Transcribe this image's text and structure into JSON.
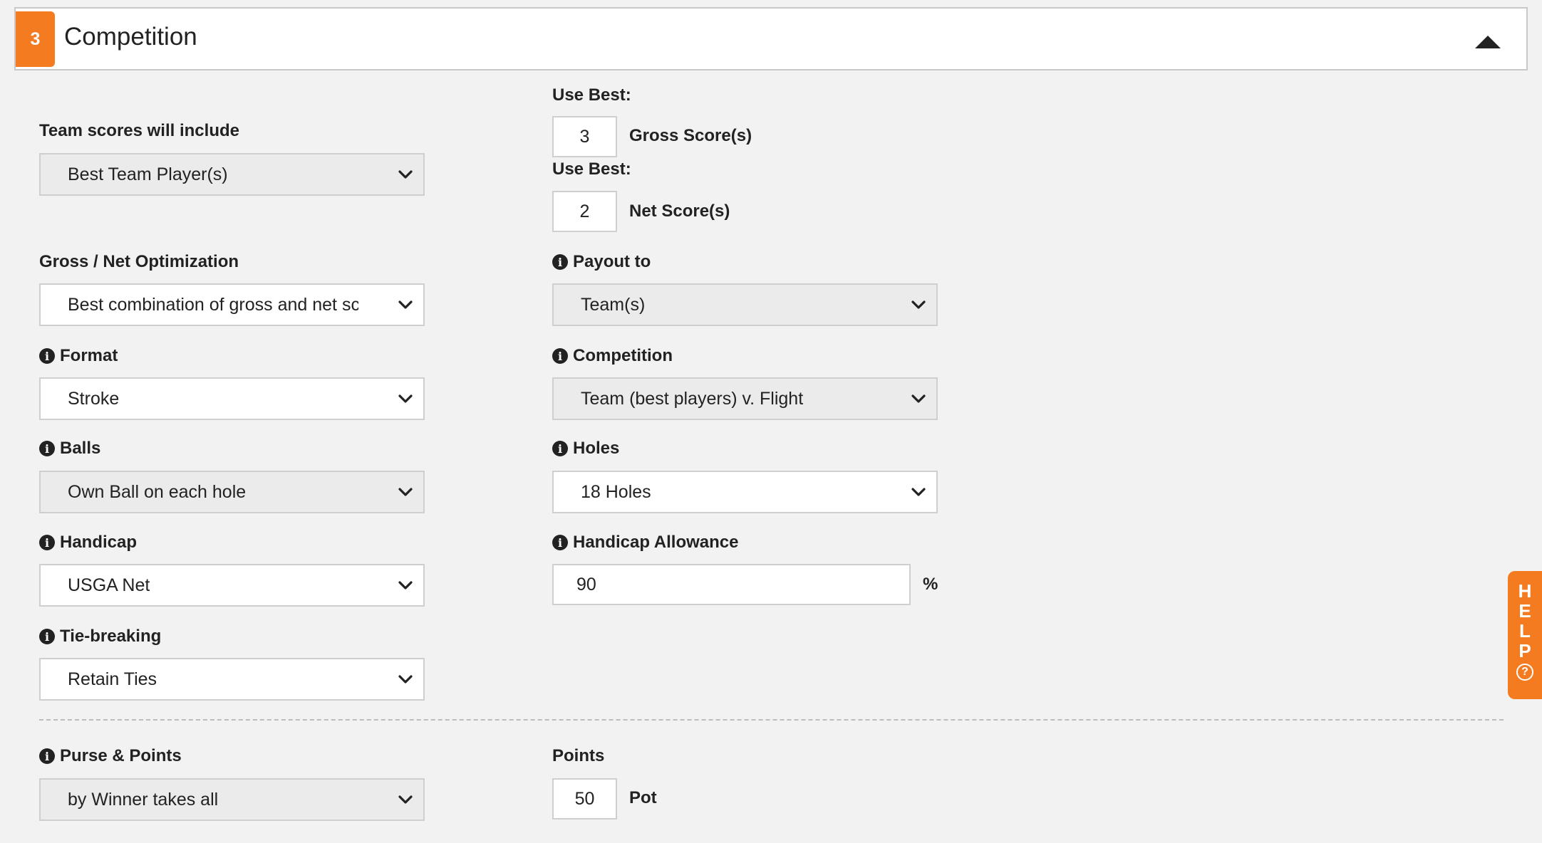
{
  "header": {
    "step_number": "3",
    "title": "Competition"
  },
  "left": {
    "team_scores": {
      "label": "Team scores will include",
      "value": "Best Team Player(s)"
    },
    "gross_net": {
      "label": "Gross / Net Optimization",
      "value": "Best combination of gross and net scores"
    },
    "format": {
      "label": "Format",
      "value": "Stroke"
    },
    "balls": {
      "label": "Balls",
      "value": "Own Ball on each hole"
    },
    "handicap": {
      "label": "Handicap",
      "value": "USGA Net"
    },
    "tie_breaking": {
      "label": "Tie-breaking",
      "value": "Retain Ties"
    },
    "purse_points": {
      "label": "Purse & Points",
      "value": "by Winner takes all"
    }
  },
  "right": {
    "use_best_gross": {
      "label": "Use Best:",
      "value": "3",
      "suffix": "Gross Score(s)"
    },
    "use_best_net": {
      "label": "Use Best:",
      "value": "2",
      "suffix": "Net Score(s)"
    },
    "payout_to": {
      "label": "Payout to",
      "value": "Team(s)"
    },
    "competition": {
      "label": "Competition",
      "value": "Team (best players) v. Flight"
    },
    "holes": {
      "label": "Holes",
      "value": "18 Holes"
    },
    "handicap_allowance": {
      "label": "Handicap Allowance",
      "value": "90",
      "suffix": "%"
    },
    "points": {
      "label": "Points",
      "value": "50",
      "suffix": "Pot"
    }
  },
  "help_tab": {
    "letters": [
      "H",
      "E",
      "L",
      "P"
    ],
    "question": "?"
  },
  "icons": {
    "info": "info-circle-icon",
    "chevron": "chevron-down-icon",
    "caret": "caret-up-icon"
  },
  "colors": {
    "accent": "#f47b20",
    "text": "#222222",
    "page_bg": "#f2f2f2",
    "disabled_select": "#ebebeb"
  }
}
